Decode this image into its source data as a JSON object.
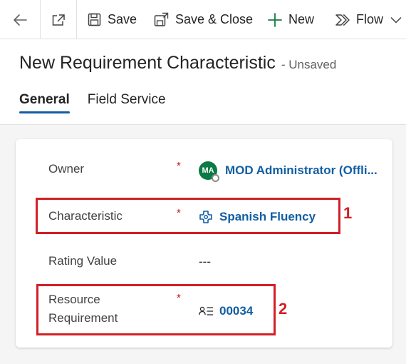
{
  "toolbar": {
    "save_label": "Save",
    "save_close_label": "Save & Close",
    "new_label": "New",
    "flow_label": "Flow"
  },
  "header": {
    "title": "New Requirement Characteristic",
    "status": "- Unsaved"
  },
  "tabs": [
    {
      "label": "General",
      "active": true
    },
    {
      "label": "Field Service",
      "active": false
    }
  ],
  "form": {
    "owner": {
      "label": "Owner",
      "required_mark": "*",
      "avatar_initials": "MA",
      "value": "MOD Administrator (Offli..."
    },
    "characteristic": {
      "label": "Characteristic",
      "required_mark": "*",
      "value": "Spanish Fluency"
    },
    "rating_value": {
      "label": "Rating Value",
      "value": "---"
    },
    "resource_requirement": {
      "label_line1": "Resource",
      "label_line2": "Requirement",
      "required_mark": "*",
      "value": "00034"
    }
  },
  "annotations": {
    "callout_1": "1",
    "callout_2": "2"
  },
  "colors": {
    "accent": "#115ea3",
    "required": "#c50f1f",
    "highlight": "#d21f26",
    "avatar": "#0b7a45"
  }
}
